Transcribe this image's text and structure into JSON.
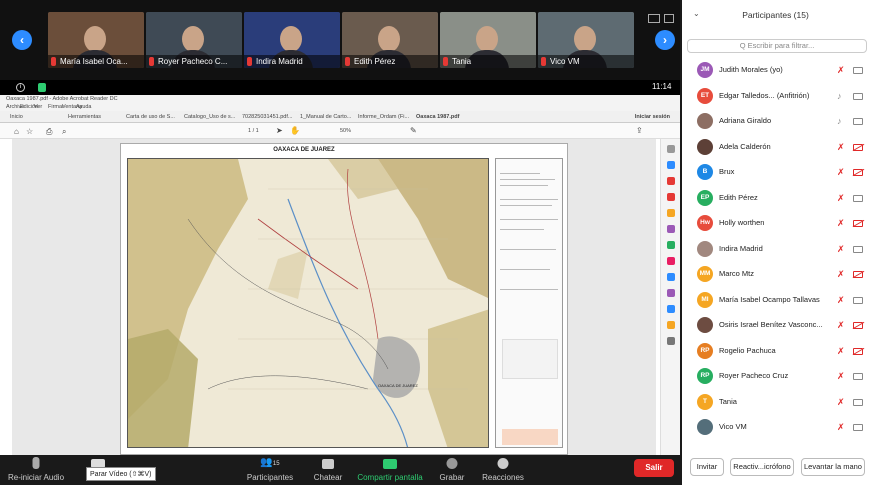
{
  "video_strip": {
    "tiles": [
      {
        "name": "María Isabel Oca...",
        "muted": true
      },
      {
        "name": "Royer Pacheco C...",
        "muted": true
      },
      {
        "name": "Indira Madrid",
        "muted": true
      },
      {
        "name": "Edith Pérez",
        "muted": true
      },
      {
        "name": "Tania",
        "muted": true
      },
      {
        "name": "Vico VM",
        "muted": true
      }
    ],
    "prev_icon": "chevron-left",
    "next_icon": "chevron-right",
    "time": "11:14"
  },
  "shared_screen": {
    "window_title": "Oaxaca 1987.pdf - Adobe Acrobat Reader DC",
    "menu": [
      "Archivo",
      "Edición",
      "Ver",
      "Firmar",
      "Ventana",
      "Ayuda"
    ],
    "tabs": [
      "Inicio",
      "Herramientas",
      "Carta de uso de S...",
      "Catalogo_Uso de s...",
      "702825031451.pdf...",
      "1_Manual de Carto...",
      "Informe_Ordam (Fi...",
      "Oaxaca 1987.pdf"
    ],
    "signin": "Iniciar sesión",
    "page_indicator": "1 / 1",
    "zoom": "50%",
    "map_title": "OAXACA DE JUAREZ",
    "city_label": "OAXACA DE JUAREZ"
  },
  "bottom_bar": {
    "reinit_audio": "Re-iniciar Audio",
    "video": "Parar Video",
    "tooltip": "Parar Vídeo (⇧⌘V)",
    "participants": "Participantes",
    "participants_count": "15",
    "chat": "Chatear",
    "share": "Compartir pantalla",
    "record": "Grabar",
    "reactions": "Reacciones",
    "leave": "Salir"
  },
  "participants_panel": {
    "title": "Participantes (15)",
    "search_placeholder": "Q  Escribir para filtrar...",
    "people": [
      {
        "initials": "JM",
        "name": "Judith Morales (yo)",
        "color": "#9b59b6",
        "mic": "off",
        "cam": "on"
      },
      {
        "initials": "ET",
        "name": "Edgar Talledos... (Anfitrión)",
        "color": "#e74c3c",
        "mic": "on",
        "cam": "on"
      },
      {
        "initials": "",
        "name": "Adriana Giraldo",
        "color": "#8d6e63",
        "mic": "on",
        "cam": "on"
      },
      {
        "initials": "",
        "name": "Adela Calderón",
        "color": "#5d4037",
        "mic": "off",
        "cam": "off"
      },
      {
        "initials": "B",
        "name": "Brux",
        "color": "#1e88e5",
        "mic": "off",
        "cam": "off"
      },
      {
        "initials": "EP",
        "name": "Edith Pérez",
        "color": "#27ae60",
        "mic": "off",
        "cam": "on"
      },
      {
        "initials": "Hw",
        "name": "Holly worthen",
        "color": "#e74c3c",
        "mic": "off",
        "cam": "off"
      },
      {
        "initials": "",
        "name": "Indira Madrid",
        "color": "#a1887f",
        "mic": "off",
        "cam": "on"
      },
      {
        "initials": "MM",
        "name": "Marco Mtz",
        "color": "#f5a623",
        "mic": "off",
        "cam": "off"
      },
      {
        "initials": "MI",
        "name": "María Isabel Ocampo Tallavas",
        "color": "#f5a623",
        "mic": "off",
        "cam": "on"
      },
      {
        "initials": "",
        "name": "Osiris Israel Benítez Vasconc...",
        "color": "#6d4c41",
        "mic": "off",
        "cam": "off"
      },
      {
        "initials": "RP",
        "name": "Rogelio Pachuca",
        "color": "#e67e22",
        "mic": "off",
        "cam": "off"
      },
      {
        "initials": "RP",
        "name": "Royer Pacheco Cruz",
        "color": "#27ae60",
        "mic": "off",
        "cam": "on"
      },
      {
        "initials": "T",
        "name": "Tania",
        "color": "#f5a623",
        "mic": "off",
        "cam": "on"
      },
      {
        "initials": "",
        "name": "Vico VM",
        "color": "#546e7a",
        "mic": "off",
        "cam": "on"
      }
    ],
    "invite": "Invitar",
    "reactivate_mic": "Reactiv...icrófono",
    "raise_hand": "Levantar la mano"
  }
}
